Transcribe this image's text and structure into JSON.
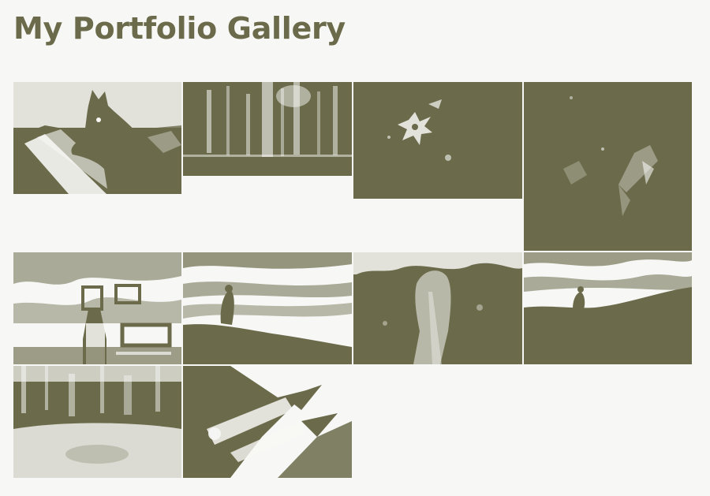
{
  "page": {
    "title": "My Portfolio Gallery"
  },
  "colors": {
    "accent": "#6b6b4b",
    "light": "#f7f7f5",
    "background": "#f7f7f5"
  },
  "gallery": {
    "photos": [
      {
        "subject": "horse-by-fence"
      },
      {
        "subject": "forest-trees"
      },
      {
        "subject": "flower-in-dark"
      },
      {
        "subject": "dark-foliage"
      },
      {
        "subject": "person-with-frames"
      },
      {
        "subject": "sea-of-clouds-hiker"
      },
      {
        "subject": "person-in-field"
      },
      {
        "subject": "sunset-silhouette"
      },
      {
        "subject": "city-plaza"
      },
      {
        "subject": "ice-cream-cones"
      }
    ]
  }
}
